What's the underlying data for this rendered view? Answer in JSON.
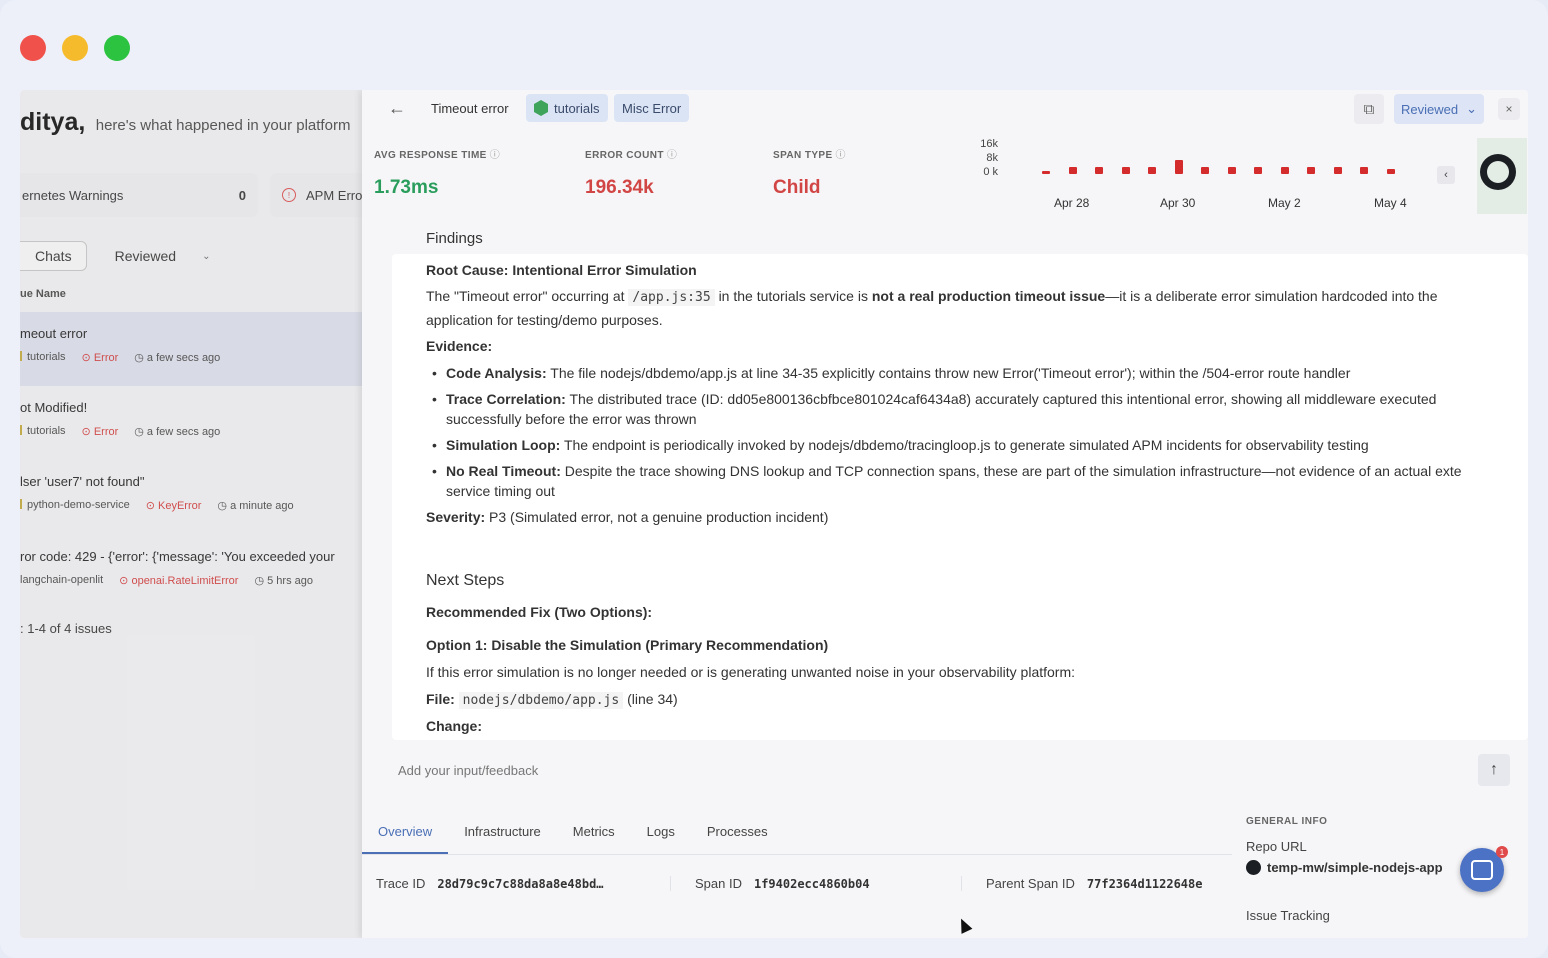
{
  "left": {
    "greeting_name": "ditya,",
    "greeting_rest": "here's what happened in your platform",
    "k8s_label": "ernetes Warnings",
    "k8s_count": "0",
    "apm_label": "APM Erro",
    "tab_chats": "Chats",
    "tab_reviewed": "Reviewed",
    "col_head": "ue Name",
    "issues": [
      {
        "title": "meout error",
        "service": "tutorials",
        "type": "Error",
        "time": "a few secs ago"
      },
      {
        "title": "ot Modified!",
        "service": "tutorials",
        "type": "Error",
        "time": "a few secs ago"
      },
      {
        "title": "lser 'user7' not found\"",
        "service": "python-demo-service",
        "type": "KeyError",
        "time": "a minute ago"
      },
      {
        "title": "ror code: 429 - {'error': {'message': 'You exceeded your",
        "service": "langchain-openlit",
        "type": "openai.RateLimitError",
        "time": "5 hrs ago"
      }
    ],
    "pager": ": 1-4 of 4 issues"
  },
  "detail": {
    "title": "Timeout error",
    "chip_tutorials": "tutorials",
    "chip_misc": "Misc Error",
    "reviewed": "Reviewed",
    "close": "×",
    "metrics": {
      "avg_label": "AVG RESPONSE TIME",
      "avg_value": "1.73ms",
      "err_label": "ERROR COUNT",
      "err_value": "196.34k",
      "span_label": "SPAN TYPE",
      "span_value": "Child"
    },
    "findings_head": "Findings",
    "root_cause": "Root Cause: Intentional Error Simulation",
    "rc_pre": "The \"Timeout error\" occurring at",
    "rc_code": "/app.js:35",
    "rc_mid": "in the tutorials service is",
    "rc_bold": "not a real production timeout issue",
    "rc_post": "—it is a deliberate error simulation hardcoded into the",
    "rc_line2": "application for testing/demo purposes.",
    "evidence": "Evidence:",
    "ev1_b": "Code Analysis:",
    "ev1": "The file nodejs/dbdemo/app.js at line 34-35 explicitly contains throw new Error('Timeout error'); within the /504-error route handler",
    "ev2_b": "Trace Correlation:",
    "ev2": "The distributed trace (ID: dd05e800136cbfbce801024caf6434a8) accurately captured this intentional error, showing all middleware executed",
    "ev2_l2": "successfully before the error was thrown",
    "ev3_b": "Simulation Loop:",
    "ev3": "The endpoint is periodically invoked by nodejs/dbdemo/tracingloop.js to generate simulated APM incidents for observability testing",
    "ev4_b": "No Real Timeout:",
    "ev4": "Despite the trace showing DNS lookup and TCP connection spans, these are part of the simulation infrastructure—not evidence of an actual exte",
    "ev4_l2": "service timing out",
    "sev_b": "Severity:",
    "sev": "P3 (Simulated error, not a genuine production incident)",
    "next_steps": "Next Steps",
    "rec_fix": "Recommended Fix (Two Options):",
    "opt1": "Option 1: Disable the Simulation (Primary Recommendation)",
    "opt1_text": "If this error simulation is no longer needed or is generating unwanted noise in your observability platform:",
    "file_b": "File:",
    "file_code": "nodejs/dbdemo/app.js",
    "file_line": "(line 34)",
    "change_b": "Change:",
    "feedback_placeholder": "Add your input/feedback",
    "tabs": [
      "Overview",
      "Infrastructure",
      "Metrics",
      "Logs",
      "Processes"
    ],
    "trace_label": "Trace ID",
    "trace_value": "28d79c9c7c88da8a8e48bd…",
    "span_label": "Span ID",
    "span_value": "1f9402ecc4860b04",
    "parent_label": "Parent Span ID",
    "parent_value": "77f2364d1122648e",
    "gen_info": "GENERAL INFO",
    "repo_label": "Repo URL",
    "repo_value": "temp-mw/simple-nodejs-app",
    "issue_tracking": "Issue Tracking",
    "chat_badge": "1"
  },
  "chart_data": {
    "type": "bar",
    "y_ticks": [
      "16k",
      "8k",
      "0 k"
    ],
    "x_ticks": [
      "Apr 28",
      "Apr 30",
      "May 2",
      "May 4"
    ],
    "ylim": [
      0,
      16000
    ],
    "values": [
      1200,
      3500,
      3500,
      3500,
      3500,
      7500,
      3500,
      3500,
      3500,
      3500,
      3500,
      3500,
      3500,
      2500
    ],
    "color": "#d42c2c"
  }
}
